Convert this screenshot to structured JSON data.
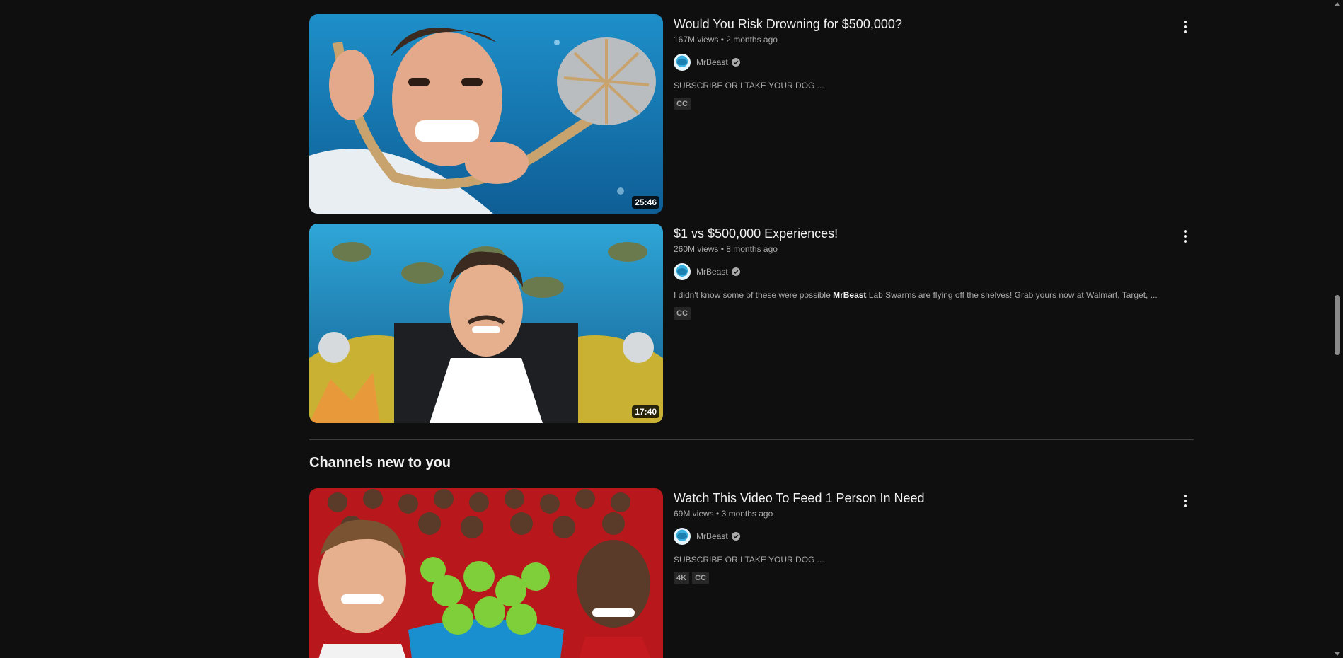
{
  "videos": [
    {
      "title": "Would You Risk Drowning for $500,000?",
      "views": "167M views",
      "age": "2 months ago",
      "channel": "MrBeast",
      "description": "SUBSCRIBE OR I TAKE YOUR DOG ...",
      "badges": [
        "CC"
      ],
      "duration": "25:46"
    },
    {
      "title": "$1 vs $500,000 Experiences!",
      "views": "260M views",
      "age": "8 months ago",
      "channel": "MrBeast",
      "description_before": "I didn't know some of these were possible ",
      "description_bold": "MrBeast",
      "description_after": " Lab Swarms are flying off the shelves! Grab yours now at Walmart, Target, ...",
      "badges": [
        "CC"
      ],
      "duration": "17:40"
    },
    {
      "title": "Watch This Video To Feed 1 Person In Need",
      "views": "69M views",
      "age": "3 months ago",
      "channel": "MrBeast",
      "description": "SUBSCRIBE OR I TAKE YOUR DOG ...",
      "badges": [
        "4K",
        "CC"
      ]
    }
  ],
  "section": {
    "title": "Channels new to you"
  },
  "separator": " • ",
  "icons": {
    "more": "more-vert-icon",
    "verified": "verified-check-icon"
  },
  "colors": {
    "background": "#0f0f0f",
    "primary_text": "#f1f1f1",
    "secondary_text": "#aaaaaa",
    "badge_bg": "#272727"
  }
}
